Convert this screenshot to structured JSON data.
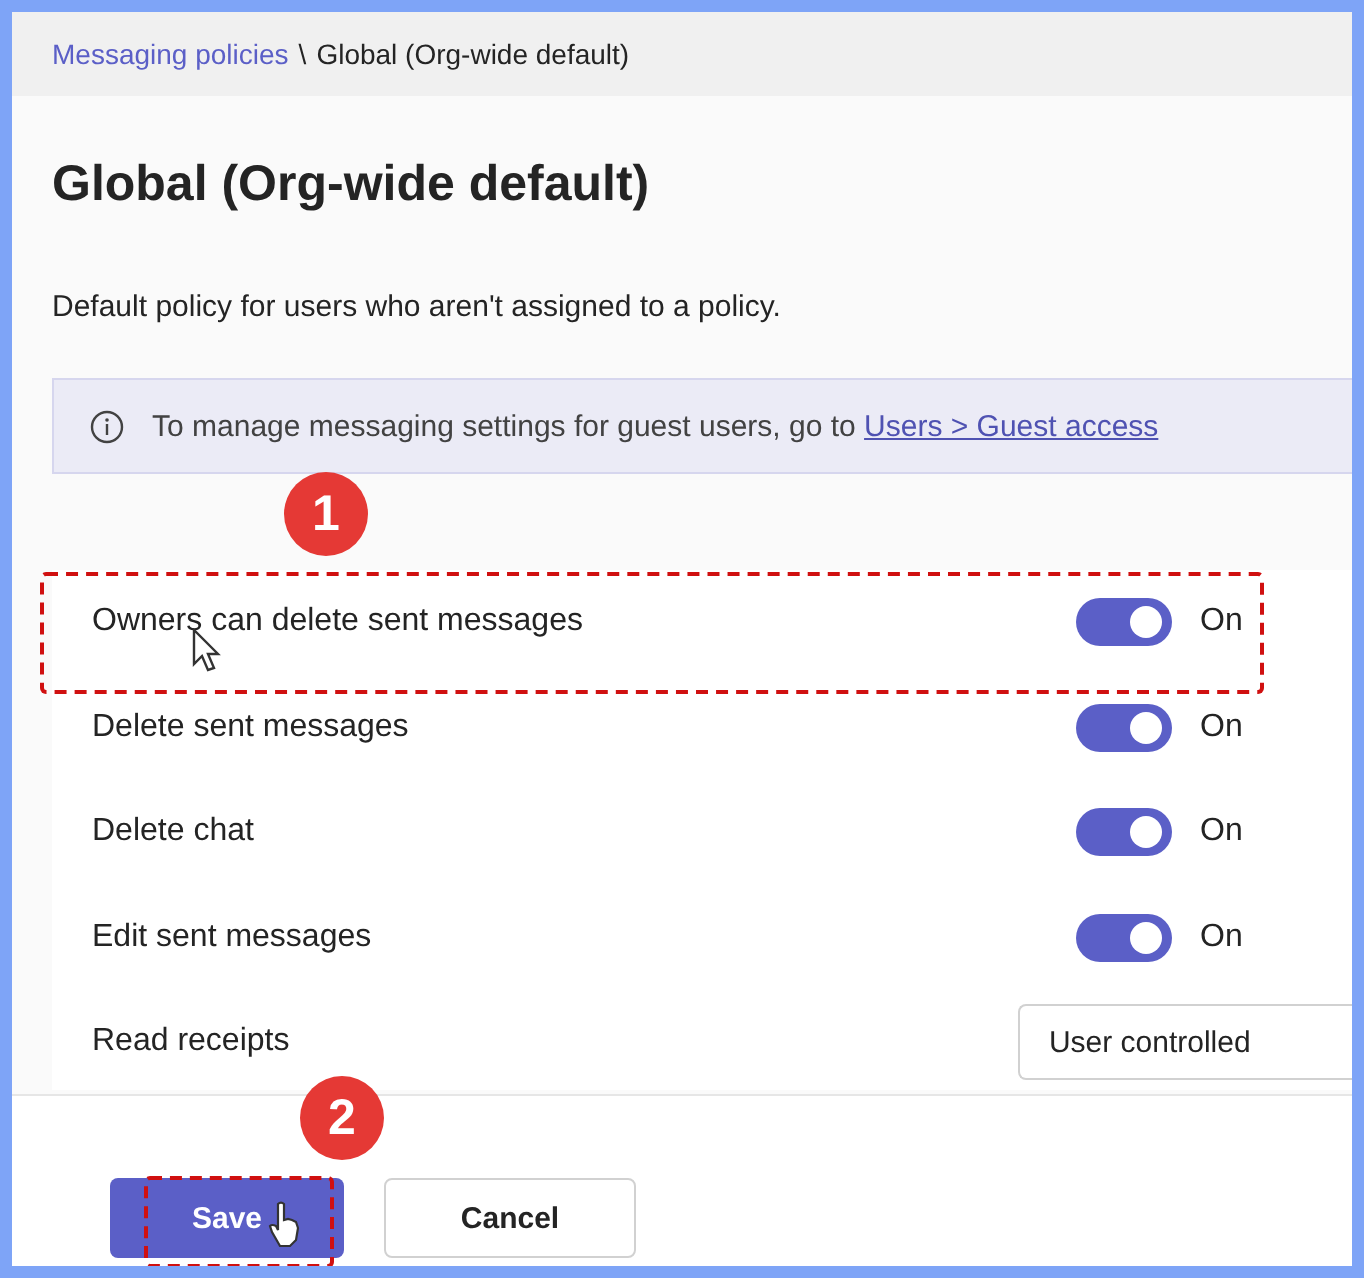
{
  "breadcrumb": {
    "parent": "Messaging policies",
    "separator": "\\",
    "current": "Global (Org-wide default)"
  },
  "title": "Global (Org-wide default)",
  "description": "Default policy for users who aren't assigned to a policy.",
  "info": {
    "text": "To manage messaging settings for guest users, go to",
    "link": "Users > Guest access"
  },
  "settings": [
    {
      "kind": "toggle",
      "label": "Owners can delete sent messages",
      "on": true,
      "state": "On",
      "highlighted": true
    },
    {
      "kind": "toggle",
      "label": "Delete sent messages",
      "on": true,
      "state": "On",
      "highlighted": false
    },
    {
      "kind": "toggle",
      "label": "Delete chat",
      "on": true,
      "state": "On",
      "highlighted": false
    },
    {
      "kind": "toggle",
      "label": "Edit sent messages",
      "on": true,
      "state": "On",
      "highlighted": false
    },
    {
      "kind": "dropdown",
      "label": "Read receipts",
      "value": "User controlled",
      "highlighted": false
    }
  ],
  "buttons": [
    {
      "kind": "primary",
      "label": "Save",
      "highlighted": true
    },
    {
      "kind": "secondary",
      "label": "Cancel",
      "highlighted": false
    }
  ],
  "annotations": [
    {
      "number": "1"
    },
    {
      "number": "2"
    }
  ]
}
